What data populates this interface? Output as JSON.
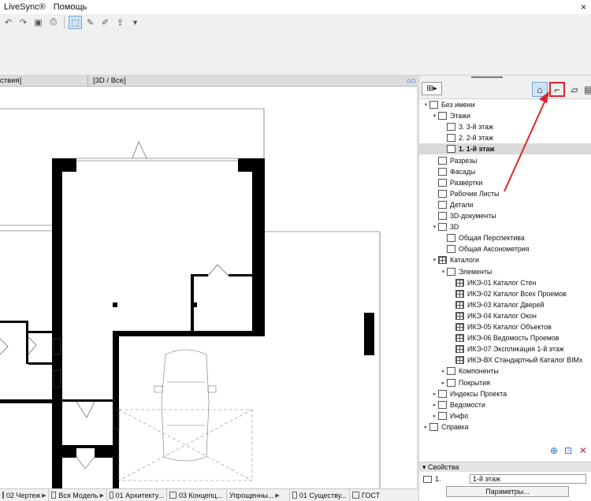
{
  "menu": {
    "items": [
      "LiveSync®",
      "Помощь"
    ],
    "window_close": "×"
  },
  "tabs": {
    "tab1": "ствия]",
    "tab2": "[3D / Все]"
  },
  "navigator": {
    "items": [
      {
        "label": "Без имени",
        "level": 0,
        "toggle": "v"
      },
      {
        "label": "Этажи",
        "level": 1,
        "toggle": "v"
      },
      {
        "label": "3. 3-й этаж",
        "level": 2,
        "toggle": ""
      },
      {
        "label": "2. 2-й этаж",
        "level": 2,
        "toggle": ""
      },
      {
        "label": "1. 1-й этаж",
        "level": 2,
        "toggle": "",
        "selected": true
      },
      {
        "label": "Разрезы",
        "level": 1,
        "toggle": ""
      },
      {
        "label": "Фасады",
        "level": 1,
        "toggle": ""
      },
      {
        "label": "Развертки",
        "level": 1,
        "toggle": ""
      },
      {
        "label": "Рабочие Листы",
        "level": 1,
        "toggle": ""
      },
      {
        "label": "Детали",
        "level": 1,
        "toggle": ""
      },
      {
        "label": "3D-документы",
        "level": 1,
        "toggle": ""
      },
      {
        "label": "3D",
        "level": 1,
        "toggle": "v"
      },
      {
        "label": "Общая Перспектива",
        "level": 2,
        "toggle": ""
      },
      {
        "label": "Общая Аксонометрия",
        "level": 2,
        "toggle": ""
      },
      {
        "label": "Каталоги",
        "level": 1,
        "toggle": "v"
      },
      {
        "label": "Элементы",
        "level": 2,
        "toggle": "v"
      },
      {
        "label": "ИКЭ-01 Каталог Стен",
        "level": 3,
        "toggle": ""
      },
      {
        "label": "ИКЭ-02 Каталог Всех Проемов",
        "level": 3,
        "toggle": ""
      },
      {
        "label": "ИКЭ-03 Каталог Дверей",
        "level": 3,
        "toggle": ""
      },
      {
        "label": "ИКЭ-04 Каталог Окон",
        "level": 3,
        "toggle": ""
      },
      {
        "label": "ИКЭ-05 Каталог Объектов",
        "level": 3,
        "toggle": ""
      },
      {
        "label": "ИКЭ-06 Ведомость Проемов",
        "level": 3,
        "toggle": ""
      },
      {
        "label": "ИКЭ-07 Экспликация 1-й этаж",
        "level": 3,
        "toggle": ""
      },
      {
        "label": "ИКЭ-ВХ Стандартный Каталог BIMx",
        "level": 3,
        "toggle": ""
      },
      {
        "label": "Компоненты",
        "level": 2,
        "toggle": ">"
      },
      {
        "label": "Покрытия",
        "level": 2,
        "toggle": ">"
      },
      {
        "label": "Индексы Проекта",
        "level": 1,
        "toggle": ">"
      },
      {
        "label": "Ведомости",
        "level": 1,
        "toggle": ">"
      },
      {
        "label": "Инфо",
        "level": 1,
        "toggle": ">"
      },
      {
        "label": "Справка",
        "level": 0,
        "toggle": ">"
      }
    ]
  },
  "properties": {
    "title": "Свойства",
    "id_label": "1.",
    "id_value": "1-й этаж",
    "params_button": "Параметры..."
  },
  "statusbar": {
    "items": [
      "02 Чертеж",
      "Вся Модель",
      "01 Архитекту...",
      "03 Концепц...",
      "Упрощенны...",
      "01 Существу...",
      "ГОСТ"
    ]
  },
  "colors": {
    "accent": "#2a6bbd",
    "highlight": "#d9262a",
    "selected_row": "#d9d9d9"
  },
  "icons": [
    "folder-icon",
    "floor-plan-icon",
    "section-icon",
    "elevation-icon",
    "sheet-icon",
    "detail-icon",
    "3d-icon",
    "schedule-icon",
    "add-view-icon",
    "settings-icon",
    "delete-icon"
  ]
}
